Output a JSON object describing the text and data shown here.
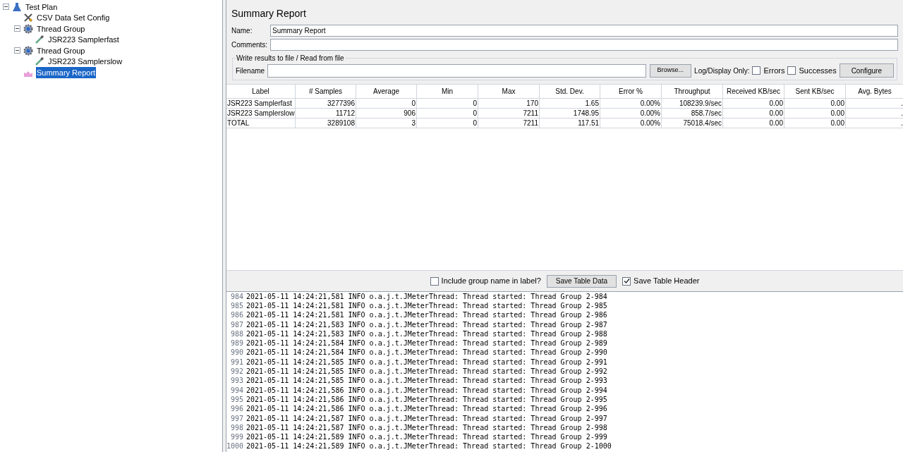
{
  "tree": [
    {
      "label": "Test Plan",
      "kind": "plan",
      "selected": false,
      "expanded": true,
      "children": [
        {
          "label": "CSV Data Set Config",
          "kind": "config",
          "selected": false
        },
        {
          "label": "Thread Group",
          "kind": "threads",
          "selected": false,
          "expanded": true,
          "children": [
            {
              "label": "JSR223 Samplerfast",
              "kind": "sampler",
              "selected": false
            }
          ]
        },
        {
          "label": "Thread Group",
          "kind": "threads",
          "selected": false,
          "expanded": true,
          "children": [
            {
              "label": "JSR223 Samplerslow",
              "kind": "sampler",
              "selected": false
            }
          ]
        },
        {
          "label": "Summary Report",
          "kind": "report",
          "selected": true
        }
      ]
    }
  ],
  "panel": {
    "title": "Summary Report",
    "name_label": "Name:",
    "name_value": "Summary Report",
    "comments_label": "Comments:",
    "file_group": {
      "legend": "Write results to file / Read from file",
      "filename_label": "Filename",
      "browse": "Browse...",
      "log_label": "Log/Display Only:",
      "errors": {
        "label": "Errors",
        "checked": false
      },
      "successes": {
        "label": "Successes",
        "checked": false
      },
      "configure": "Configure"
    }
  },
  "table": {
    "columns": [
      "Label",
      "# Samples",
      "Average",
      "Min",
      "Max",
      "Std. Dev.",
      "Error %",
      "Throughput",
      "Received KB/sec",
      "Sent KB/sec",
      "Avg. Bytes"
    ],
    "rows": [
      [
        "JSR223 Samplerfast",
        "3277396",
        "0",
        "0",
        "170",
        "1.65",
        "0.00%",
        "108239.9/sec",
        "0.00",
        "0.00",
        "."
      ],
      [
        "JSR223 Samplerslow",
        "11712",
        "906",
        "0",
        "7211",
        "1748.95",
        "0.00%",
        "858.7/sec",
        "0.00",
        "0.00",
        "."
      ],
      [
        "TOTAL",
        "3289108",
        "3",
        "0",
        "7211",
        "117.51",
        "0.00%",
        "75018.4/sec",
        "0.00",
        "0.00",
        "."
      ]
    ]
  },
  "bottom_bar": {
    "include_group": {
      "label": "Include group name in label?",
      "checked": false
    },
    "save_data": "Save Table Data",
    "save_header": {
      "label": "Save Table Header",
      "checked": true
    }
  },
  "log": [
    {
      "n": "984",
      "text": "2021-05-11 14:24:21,581 INFO o.a.j.t.JMeterThread: Thread started: Thread Group 2-984"
    },
    {
      "n": "985",
      "text": "2021-05-11 14:24:21,581 INFO o.a.j.t.JMeterThread: Thread started: Thread Group 2-985"
    },
    {
      "n": "986",
      "text": "2021-05-11 14:24:21,581 INFO o.a.j.t.JMeterThread: Thread started: Thread Group 2-986"
    },
    {
      "n": "987",
      "text": "2021-05-11 14:24:21,583 INFO o.a.j.t.JMeterThread: Thread started: Thread Group 2-987"
    },
    {
      "n": "988",
      "text": "2021-05-11 14:24:21,583 INFO o.a.j.t.JMeterThread: Thread started: Thread Group 2-988"
    },
    {
      "n": "989",
      "text": "2021-05-11 14:24:21,584 INFO o.a.j.t.JMeterThread: Thread started: Thread Group 2-989"
    },
    {
      "n": "990",
      "text": "2021-05-11 14:24:21,584 INFO o.a.j.t.JMeterThread: Thread started: Thread Group 2-990"
    },
    {
      "n": "991",
      "text": "2021-05-11 14:24:21,585 INFO o.a.j.t.JMeterThread: Thread started: Thread Group 2-991"
    },
    {
      "n": "992",
      "text": "2021-05-11 14:24:21,585 INFO o.a.j.t.JMeterThread: Thread started: Thread Group 2-992"
    },
    {
      "n": "993",
      "text": "2021-05-11 14:24:21,585 INFO o.a.j.t.JMeterThread: Thread started: Thread Group 2-993"
    },
    {
      "n": "994",
      "text": "2021-05-11 14:24:21,586 INFO o.a.j.t.JMeterThread: Thread started: Thread Group 2-994"
    },
    {
      "n": "995",
      "text": "2021-05-11 14:24:21,586 INFO o.a.j.t.JMeterThread: Thread started: Thread Group 2-995"
    },
    {
      "n": "996",
      "text": "2021-05-11 14:24:21,586 INFO o.a.j.t.JMeterThread: Thread started: Thread Group 2-996"
    },
    {
      "n": "997",
      "text": "2021-05-11 14:24:21,587 INFO o.a.j.t.JMeterThread: Thread started: Thread Group 2-997"
    },
    {
      "n": "998",
      "text": "2021-05-11 14:24:21,587 INFO o.a.j.t.JMeterThread: Thread started: Thread Group 2-998"
    },
    {
      "n": "999",
      "text": "2021-05-11 14:24:21,589 INFO o.a.j.t.JMeterThread: Thread started: Thread Group 2-999"
    },
    {
      "n": "1000",
      "text": "2021-05-11 14:24:21,589 INFO o.a.j.t.JMeterThread: Thread started: Thread Group 2-1000"
    }
  ]
}
